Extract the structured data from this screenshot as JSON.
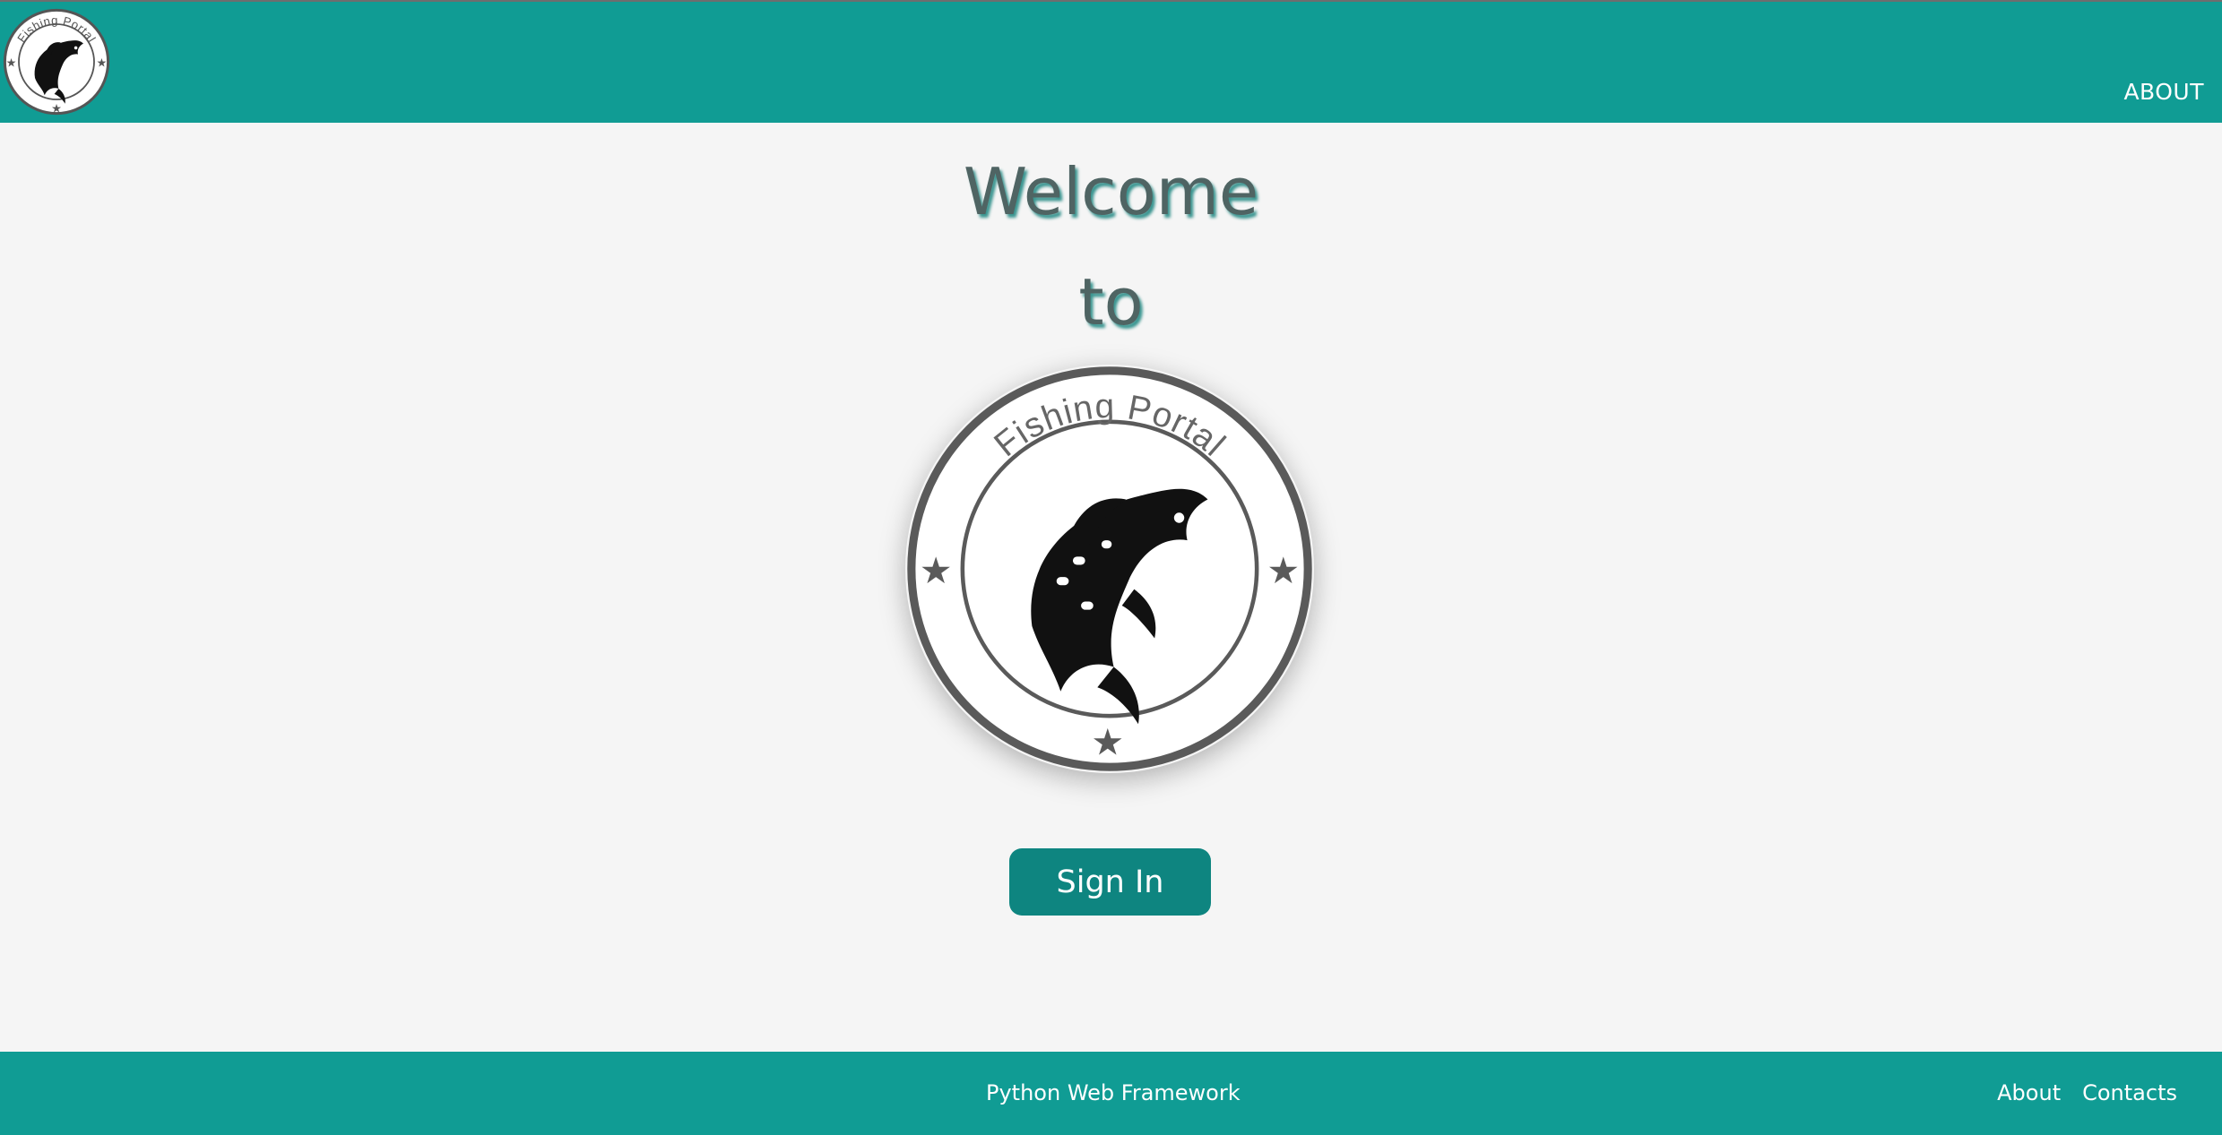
{
  "colors": {
    "accent": "#109c94",
    "button": "#0e8580",
    "heading": "#4f6463",
    "background": "#f5f5f5"
  },
  "header": {
    "logo": {
      "icon": "fishing-portal-logo-icon",
      "text": "Fishing Portal"
    },
    "nav": {
      "about_label": "ABOUT"
    }
  },
  "main": {
    "welcome_line1": "Welcome",
    "welcome_line2": "to",
    "logo": {
      "icon": "fishing-portal-logo-icon",
      "text": "Fishing Portal"
    },
    "sign_in_label": "Sign In"
  },
  "footer": {
    "center_text": "Python Web Framework",
    "links": [
      {
        "label": "About"
      },
      {
        "label": "Contacts"
      }
    ]
  }
}
